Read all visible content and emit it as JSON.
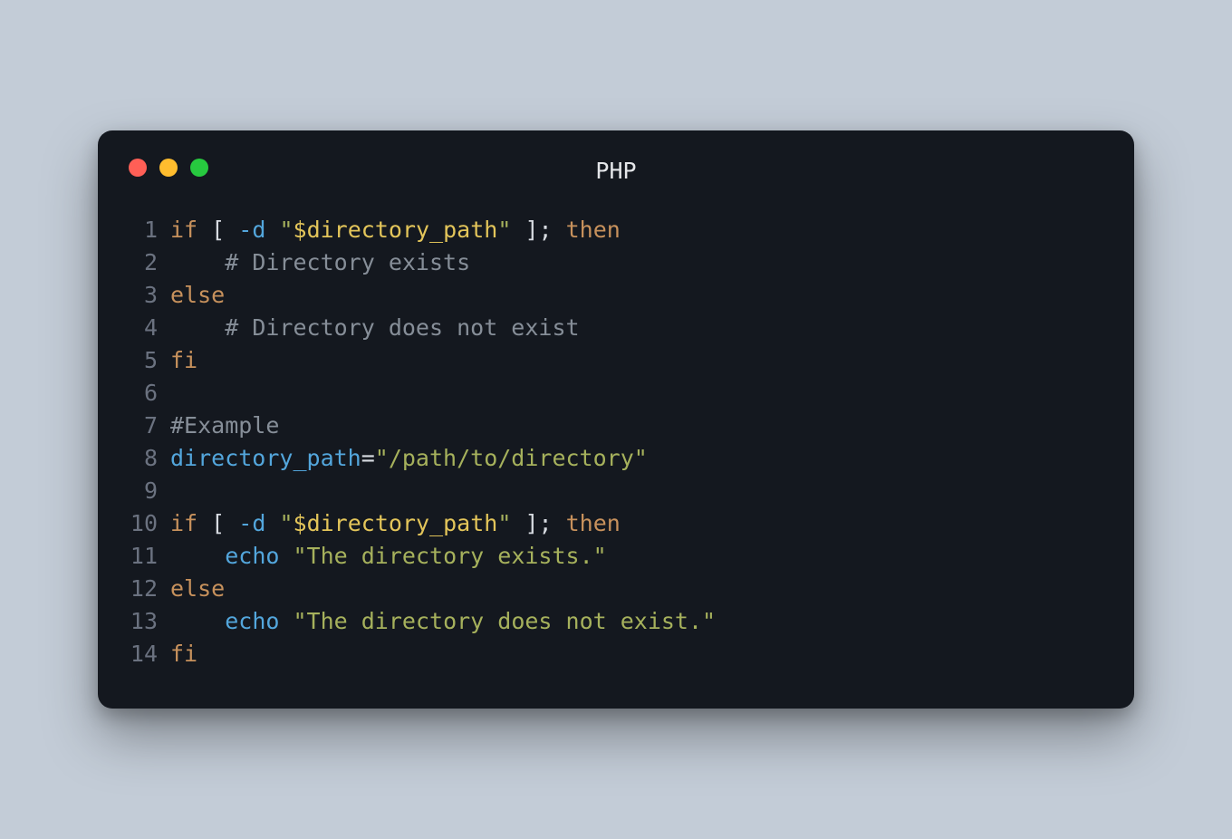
{
  "window": {
    "title": "PHP",
    "dots": {
      "red": "#ff5f56",
      "yellow": "#ffbd2e",
      "green": "#27c93f"
    }
  },
  "colors": {
    "page_bg": "#c3ccd7",
    "window_bg": "#14181f",
    "gutter": "#6b7280",
    "keyword": "#c7915c",
    "flag": "#53a6dc",
    "string": "#a6b15c",
    "variable": "#e3c55a",
    "comment": "#868e98",
    "identifier": "#53a6dc",
    "default": "#d7dbe1"
  },
  "code": {
    "line_count": 14,
    "plain_lines": [
      "if [ -d \"$directory_path\" ]; then",
      "    # Directory exists",
      "else",
      "    # Directory does not exist",
      "fi",
      "",
      "#Example",
      "directory_path=\"/path/to/directory\"",
      "",
      "if [ -d \"$directory_path\" ]; then",
      "    echo \"The directory exists.\"",
      "else",
      "    echo \"The directory does not exist.\"",
      "fi"
    ],
    "tokens": [
      [
        {
          "t": "if",
          "c": "kw"
        },
        {
          "t": " ",
          "c": "pu"
        },
        {
          "t": "[",
          "c": "pu"
        },
        {
          "t": " ",
          "c": "pu"
        },
        {
          "t": "-d",
          "c": "fl"
        },
        {
          "t": " ",
          "c": "pu"
        },
        {
          "t": "\"",
          "c": "st"
        },
        {
          "t": "$directory_path",
          "c": "va"
        },
        {
          "t": "\"",
          "c": "st"
        },
        {
          "t": " ",
          "c": "pu"
        },
        {
          "t": "]",
          "c": "pu"
        },
        {
          "t": ";",
          "c": "pu"
        },
        {
          "t": " ",
          "c": "pu"
        },
        {
          "t": "then",
          "c": "kw"
        }
      ],
      [
        {
          "t": "    ",
          "c": "pu"
        },
        {
          "t": "# Directory exists",
          "c": "cm"
        }
      ],
      [
        {
          "t": "else",
          "c": "kw"
        }
      ],
      [
        {
          "t": "    ",
          "c": "pu"
        },
        {
          "t": "# Directory does not exist",
          "c": "cm"
        }
      ],
      [
        {
          "t": "fi",
          "c": "kw"
        }
      ],
      [],
      [
        {
          "t": "#Example",
          "c": "cm"
        }
      ],
      [
        {
          "t": "directory_path",
          "c": "id"
        },
        {
          "t": "=",
          "c": "op"
        },
        {
          "t": "\"/path/to/directory\"",
          "c": "st"
        }
      ],
      [],
      [
        {
          "t": "if",
          "c": "kw"
        },
        {
          "t": " ",
          "c": "pu"
        },
        {
          "t": "[",
          "c": "pu"
        },
        {
          "t": " ",
          "c": "pu"
        },
        {
          "t": "-d",
          "c": "fl"
        },
        {
          "t": " ",
          "c": "pu"
        },
        {
          "t": "\"",
          "c": "st"
        },
        {
          "t": "$directory_path",
          "c": "va"
        },
        {
          "t": "\"",
          "c": "st"
        },
        {
          "t": " ",
          "c": "pu"
        },
        {
          "t": "]",
          "c": "pu"
        },
        {
          "t": ";",
          "c": "pu"
        },
        {
          "t": " ",
          "c": "pu"
        },
        {
          "t": "then",
          "c": "kw"
        }
      ],
      [
        {
          "t": "    ",
          "c": "pu"
        },
        {
          "t": "echo",
          "c": "id"
        },
        {
          "t": " ",
          "c": "pu"
        },
        {
          "t": "\"The directory exists.\"",
          "c": "st"
        }
      ],
      [
        {
          "t": "else",
          "c": "kw"
        }
      ],
      [
        {
          "t": "    ",
          "c": "pu"
        },
        {
          "t": "echo",
          "c": "id"
        },
        {
          "t": " ",
          "c": "pu"
        },
        {
          "t": "\"The directory does not exist.\"",
          "c": "st"
        }
      ],
      [
        {
          "t": "fi",
          "c": "kw"
        }
      ]
    ]
  }
}
